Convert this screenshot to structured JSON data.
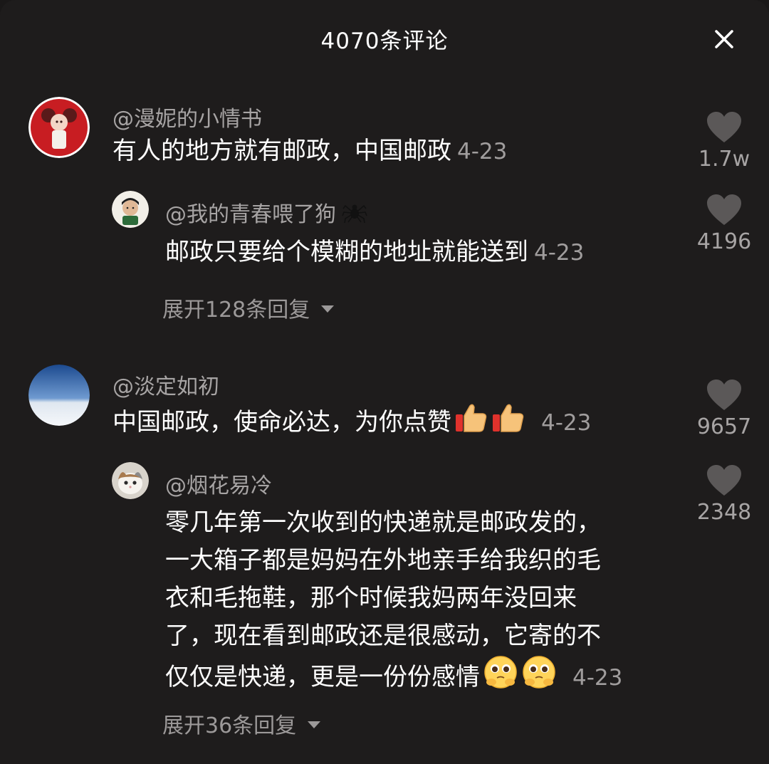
{
  "header": {
    "title": "4070条评论"
  },
  "comments": [
    {
      "user": "@漫妮的小情书",
      "text": "有人的地方就有邮政，中国邮政",
      "date": "4-23",
      "likes": "1.7w",
      "replies": [
        {
          "user": "@我的青春喂了狗",
          "text": "邮政只要给个模糊的地址就能送到",
          "date": "4-23",
          "likes": "4196"
        }
      ],
      "expand_label": "展开128条回复"
    },
    {
      "user": "@淡定如初",
      "text": "中国邮政，使命必达，为你点赞",
      "date": "4-23",
      "likes": "9657",
      "replies": [
        {
          "user": "@烟花易冷",
          "lines": [
            "零几年第一次收到的快递就是邮政发的，",
            "一大箱子都是妈妈在外地亲手给我织的毛",
            "衣和毛拖鞋，那个时候我妈两年没回来",
            "了，现在看到邮政还是很感动，它寄的不",
            "仅仅是快递，更是一份份感情"
          ],
          "date": "4-23",
          "likes": "2348"
        }
      ],
      "expand_label": "展开36条回复"
    }
  ],
  "icons": {
    "close": "close-icon",
    "like": "heart-icon",
    "expand": "caret-down-icon",
    "thumbs": "thumbs-up-emoji",
    "pleading": "pleading-face-emoji",
    "spider": "spider-emoji"
  },
  "colors": {
    "background": "#1e1c1c",
    "text_primary": "#ffffff",
    "text_secondary": "#a7a4a4",
    "heart": "#5b5858"
  }
}
